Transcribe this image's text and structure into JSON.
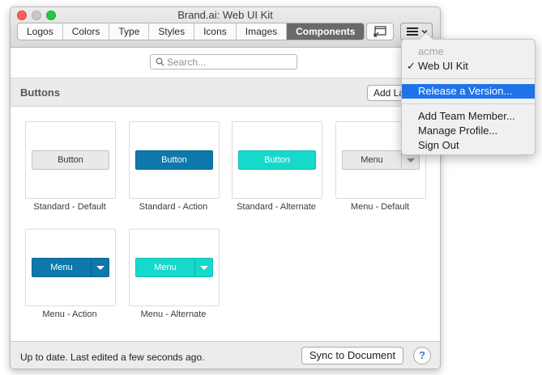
{
  "window": {
    "title": "Brand.ai: Web UI Kit"
  },
  "tabs": [
    {
      "label": "Logos"
    },
    {
      "label": "Colors"
    },
    {
      "label": "Type"
    },
    {
      "label": "Styles"
    },
    {
      "label": "Icons"
    },
    {
      "label": "Images"
    },
    {
      "label": "Components",
      "active": true
    }
  ],
  "search": {
    "placeholder": "Search..."
  },
  "section": {
    "title": "Buttons",
    "add_label": "Add La"
  },
  "cards": [
    {
      "label": "Standard - Default",
      "button_text": "Button"
    },
    {
      "label": "Standard - Action",
      "button_text": "Button"
    },
    {
      "label": "Standard - Alternate",
      "button_text": "Button"
    },
    {
      "label": "Menu - Default",
      "button_text": "Menu"
    },
    {
      "label": "Menu - Action",
      "button_text": "Menu"
    },
    {
      "label": "Menu - Alternate",
      "button_text": "Menu"
    }
  ],
  "footer": {
    "status": "Up to date. Last edited a few seconds ago.",
    "sync_label": "Sync to Document",
    "help_label": "?"
  },
  "dropdown": {
    "org": "acme",
    "selected_kit": "Web UI Kit",
    "check_mark": "✓",
    "release": "Release a Version...",
    "add_member": "Add Team Member...",
    "manage_profile": "Manage Profile...",
    "sign_out": "Sign Out"
  },
  "colors": {
    "action": "#0e77ab",
    "alternate": "#17d9cb",
    "default": "#e9e9e9",
    "highlight": "#1f73e8"
  },
  "icons": {
    "screen": "screen-icon",
    "menu": "hamburger-icon",
    "search": "search-icon"
  }
}
